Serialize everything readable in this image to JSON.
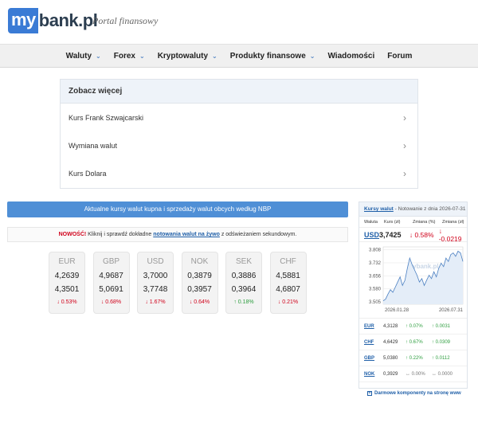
{
  "header": {
    "logo_my": "my",
    "logo_rest": "bank.pl",
    "tagline": "Portal finansowy"
  },
  "nav": {
    "items": [
      {
        "label": "Waluty",
        "dropdown": true
      },
      {
        "label": "Forex",
        "dropdown": true
      },
      {
        "label": "Kryptowaluty",
        "dropdown": true
      },
      {
        "label": "Produkty finansowe",
        "dropdown": true
      },
      {
        "label": "Wiadomości",
        "dropdown": false
      },
      {
        "label": "Forum",
        "dropdown": false
      }
    ]
  },
  "see_more": {
    "title": "Zobacz więcej",
    "items": [
      "Kurs Frank Szwajcarski",
      "Wymiana walut",
      "Kurs Dolara"
    ]
  },
  "banner": "Aktualne kursy walut kupna i sprzedaży walut obcych według NBP",
  "notice": {
    "new": "NOWOŚĆ!",
    "before": " Kliknij i sprawdź dokładne ",
    "link": "notowania walut na żywo",
    "after": " z odświeżaniem sekundowym."
  },
  "tiles": [
    {
      "code": "EUR",
      "buy": "4,2639",
      "sell": "4,3501",
      "change": "↓ 0.53%",
      "dir": "down"
    },
    {
      "code": "GBP",
      "buy": "4,9687",
      "sell": "5,0691",
      "change": "↓ 0.68%",
      "dir": "down"
    },
    {
      "code": "USD",
      "buy": "3,7000",
      "sell": "3,7748",
      "change": "↓ 1.67%",
      "dir": "down"
    },
    {
      "code": "NOK",
      "buy": "0,3879",
      "sell": "0,3957",
      "change": "↓ 0.64%",
      "dir": "down"
    },
    {
      "code": "SEK",
      "buy": "0,3886",
      "sell": "0,3964",
      "change": "↑ 0.18%",
      "dir": "up"
    },
    {
      "code": "CHF",
      "buy": "4,5881",
      "sell": "4,6807",
      "change": "↓ 0.21%",
      "dir": "down"
    }
  ],
  "widget": {
    "title": "Kursy walut",
    "subtitle": " - Notowanie z dnia 2026-07-31",
    "columns": [
      "Waluta",
      "Kurs (zł)",
      "Zmiana (%)",
      "Zmiana (zł)"
    ],
    "main": {
      "code": "USD",
      "rate": "3,7425",
      "pct": "↓ 0.58%",
      "abs": "↓ -0.0219",
      "dir": "down"
    },
    "rows": [
      {
        "code": "EUR",
        "rate": "4,3128",
        "pct": "↑ 0.07%",
        "abs": "↑ 0.0031",
        "dir": "up"
      },
      {
        "code": "CHF",
        "rate": "4,6429",
        "pct": "↑ 0.67%",
        "abs": "↑ 0.0309",
        "dir": "up"
      },
      {
        "code": "GBP",
        "rate": "5,0380",
        "pct": "↑ 0.22%",
        "abs": "↑ 0.0112",
        "dir": "up"
      },
      {
        "code": "NOK",
        "rate": "0,3929",
        "pct": "↔ 0.00%",
        "abs": "↔ 0.0000",
        "dir": "neutral"
      }
    ],
    "link": "Darmowe komponenty na stronę www"
  },
  "chart_data": {
    "type": "line",
    "title": "",
    "watermark": "mybank.pl",
    "xlabel": "",
    "ylabel": "",
    "x_ticks": [
      "2026.01.28",
      "2026.07.31"
    ],
    "y_ticks": [
      3.505,
      3.58,
      3.656,
      3.732,
      3.808
    ],
    "ylim": [
      3.49,
      3.825
    ],
    "series": [
      {
        "color": "#4a7fc1",
        "values": [
          3.51,
          3.52,
          3.55,
          3.575,
          3.56,
          3.59,
          3.62,
          3.65,
          3.6,
          3.63,
          3.7,
          3.76,
          3.72,
          3.69,
          3.66,
          3.62,
          3.64,
          3.6,
          3.63,
          3.66,
          3.64,
          3.68,
          3.65,
          3.7,
          3.73,
          3.71,
          3.76,
          3.74,
          3.78,
          3.79,
          3.77,
          3.8,
          3.79,
          3.74
        ]
      }
    ],
    "grid": true
  }
}
